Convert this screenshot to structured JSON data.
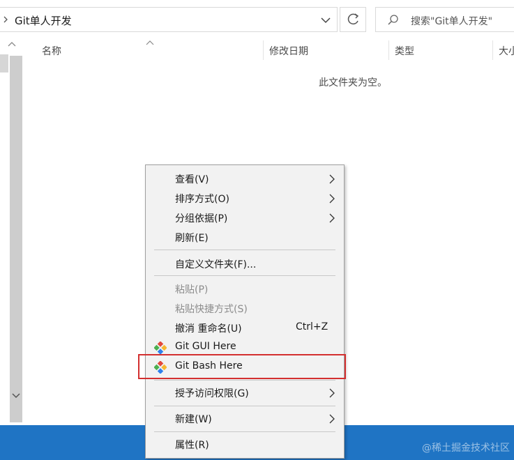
{
  "address_bar": {
    "path": "Git单人开发",
    "search_placeholder": "搜索\"Git单人开发\""
  },
  "columns": {
    "name": "名称",
    "date_modified": "修改日期",
    "type": "类型",
    "size": "大小"
  },
  "empty_message": "此文件夹为空。",
  "context_menu": {
    "items": [
      {
        "label": "查看(V)",
        "submenu": true
      },
      {
        "label": "排序方式(O)",
        "submenu": true
      },
      {
        "label": "分组依据(P)",
        "submenu": true
      },
      {
        "label": "刷新(E)"
      },
      {
        "label": "自定义文件夹(F)..."
      },
      {
        "label": "粘贴(P)",
        "disabled": true
      },
      {
        "label": "粘贴快捷方式(S)",
        "disabled": true
      },
      {
        "label": "撤消 重命名(U)",
        "shortcut": "Ctrl+Z"
      },
      {
        "label": "Git GUI Here",
        "icon": "git-icon"
      },
      {
        "label": "Git Bash Here",
        "icon": "git-icon",
        "highlighted": true
      },
      {
        "label": "授予访问权限(G)",
        "submenu": true
      },
      {
        "label": "新建(W)",
        "submenu": true
      },
      {
        "label": "属性(R)"
      }
    ]
  },
  "watermark": "@稀土掘金技术社区",
  "colors": {
    "taskbar": "#1f74c4",
    "menu_background": "#f2f2f2",
    "highlight_border": "#d32f2f",
    "git_icon_colors": [
      "#e2493b",
      "#4caf50",
      "#2f80ed",
      "#f7b731"
    ]
  }
}
